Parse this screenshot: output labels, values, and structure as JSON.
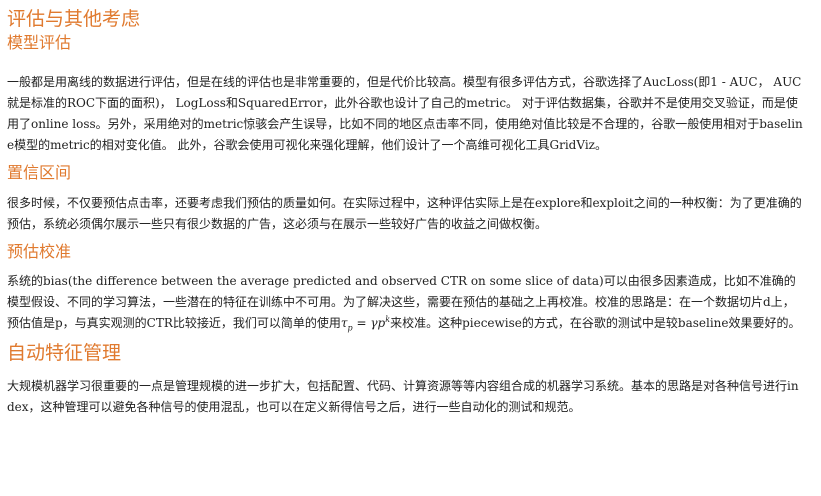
{
  "section_title": "评估与其他考虑",
  "subsections": {
    "model_eval": {
      "title": "模型评估",
      "text": "一般都是用离线的数据进行评估，但是在线的评估也是非常重要的，但是代价比较高。模型有很多评估方式，谷歌选择了AucLoss(即1 - AUC， AUC就是标准的ROC下面的面积)， LogLoss和SquaredError，此外谷歌也设计了自己的metric。 对于评估数据集，谷歌并不是使用交叉验证，而是使用了online loss。另外，采用绝对的metric惊骇会产生误导，比如不同的地区点击率不同，使用绝对值比较是不合理的，谷歌一般使用相对于baseline模型的metric的相对变化值。 此外，谷歌会使用可视化来强化理解，他们设计了一个高维可视化工具GridViz。"
    },
    "confidence": {
      "title": "置信区间",
      "text": "很多时候，不仅要预估点击率，还要考虑我们预估的质量如何。在实际过程中，这种评估实际上是在explore和exploit之间的一种权衡：为了更准确的预估，系统必须偶尔展示一些只有很少数据的广告，这必须与在展示一些较好广告的收益之间做权衡。"
    },
    "calibration": {
      "title": "预估校准",
      "text_before": "系统的bias(the difference between the average predicted and observed CTR on some slice of data)可以由很多因素造成，比如不准确的模型假设、不同的学习算法，一些潜在的特征在训练中不可用。为了解决这些，需要在预估的基础之上再校准。校准的思路是：在一个数据切片d上，预估值是p，与真实观测的CTR比较接近，我们可以简单的使用",
      "math": {
        "lhs": "τ",
        "lhs_sub": "p",
        "eq": " = ",
        "rhs": "γp",
        "rhs_sup": "k"
      },
      "text_after": "来校准。这种piecewise的方式，在谷歌的测试中是较baseline效果要好的。"
    }
  },
  "section2_title": "自动特征管理",
  "section2_text": "大规模机器学习很重要的一点是管理规模的进一步扩大，包括配置、代码、计算资源等等内容组合成的机器学习系统。基本的思路是对各种信号进行index，这种管理可以避免各种信号的使用混乱，也可以在定义新得信号之后，进行一些自动化的测试和规范。"
}
